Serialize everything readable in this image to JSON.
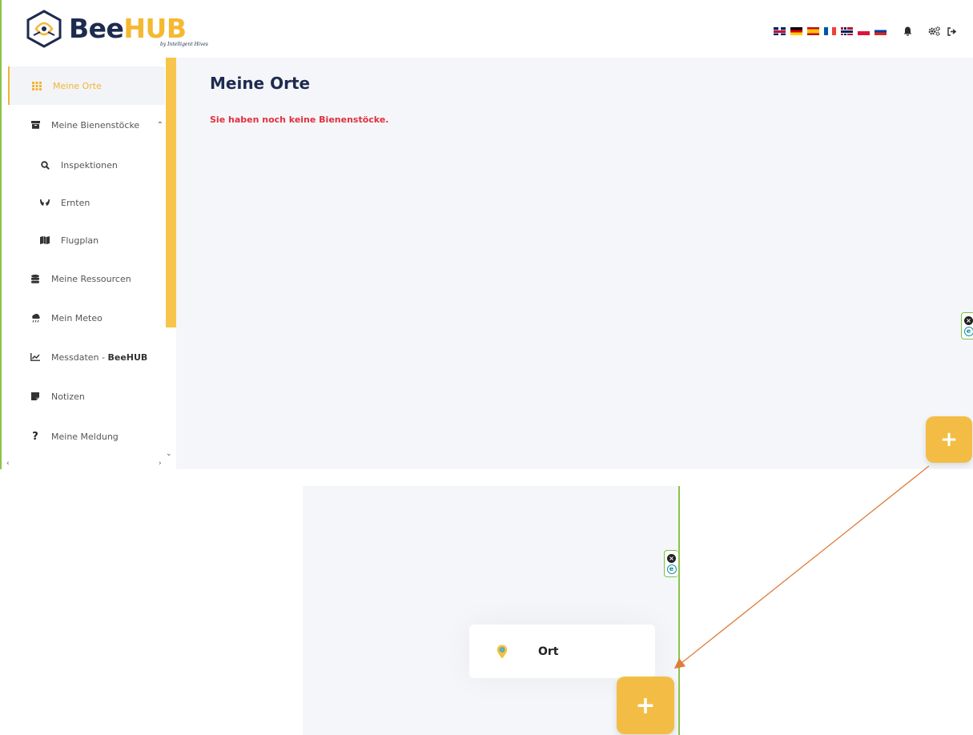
{
  "header": {
    "logo": {
      "brand_a": "Bee",
      "brand_b": "HUB",
      "tagline": "by Intelligent Hives"
    },
    "languages": [
      "English",
      "Deutsch",
      "Español",
      "Français",
      "Norsk",
      "Polski",
      "Русский"
    ],
    "icons": [
      "bell-icon",
      "cogs-icon",
      "logout-icon"
    ]
  },
  "sidebar": {
    "items": [
      {
        "label": "Meine Orte",
        "icon": "grid-icon",
        "active": true
      },
      {
        "label": "Meine Bienenstöcke",
        "icon": "archive-icon",
        "expanded": true
      },
      {
        "label": "Inspektionen",
        "icon": "search-icon",
        "sub": true
      },
      {
        "label": "Ernten",
        "icon": "hands-icon",
        "sub": true
      },
      {
        "label": "Flugplan",
        "icon": "map-icon",
        "sub": true
      },
      {
        "label": "Meine Ressourcen",
        "icon": "database-icon"
      },
      {
        "label": "Mein Meteo",
        "icon": "cloud-rain-icon"
      },
      {
        "label": "Messdaten - ",
        "label_bold": "BeeHUB",
        "icon": "chart-line-icon"
      },
      {
        "label": "Notizen",
        "icon": "sticky-note-icon"
      },
      {
        "label": "Meine Meldung",
        "icon": "question-icon"
      }
    ]
  },
  "main": {
    "title": "Meine Orte",
    "empty_message": "Sie haben noch keine Bienenstöcke."
  },
  "fab": {
    "label": "+"
  },
  "zoom": {
    "menu_item": {
      "label": "Ort",
      "icon": "map-pin-icon"
    },
    "fab_label": "+"
  },
  "colors": {
    "accent": "#f3bd45",
    "navy": "#1d2b4f",
    "error": "#e0303e",
    "annotation_arrow": "#e07b39",
    "frame_green": "#8bc34a"
  }
}
